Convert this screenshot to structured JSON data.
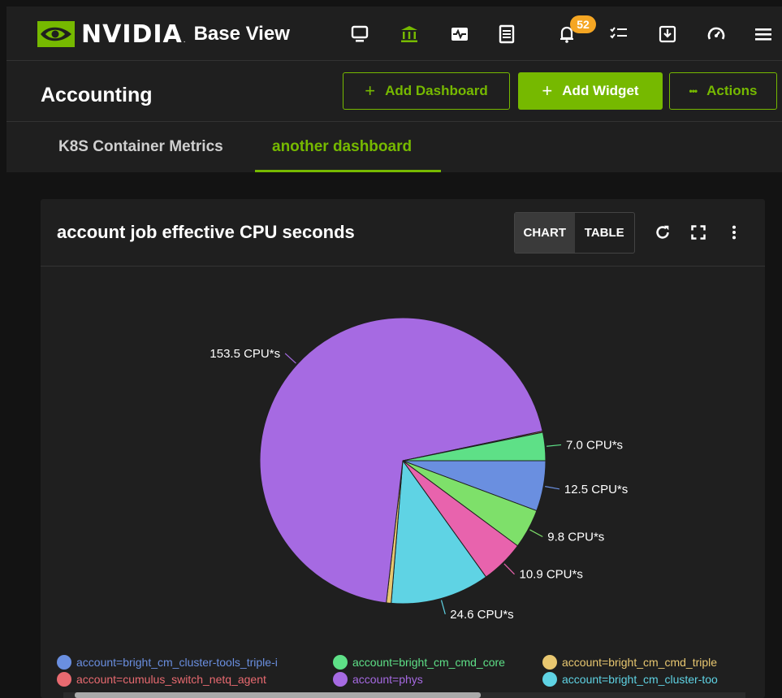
{
  "topbar": {
    "brand_name": "NVIDIA",
    "brand_reg": ".",
    "product": "Base View",
    "notification_count": "52",
    "accent": "#76b900"
  },
  "header": {
    "page_title": "Accounting",
    "add_dashboard": "Add Dashboard",
    "add_widget": "Add Widget",
    "actions": "Actions",
    "actions_dots": "•••",
    "plus": "+"
  },
  "tabs": [
    {
      "label": "K8S Container Metrics",
      "active": false
    },
    {
      "label": "another dashboard",
      "active": true
    }
  ],
  "widget": {
    "title": "account job effective CPU seconds",
    "chart_btn": "CHART",
    "table_btn": "TABLE"
  },
  "chart_data": {
    "type": "pie",
    "slices": [
      {
        "label": "12.5 CPU*s",
        "value": 12.5,
        "color": "#6a8fe0"
      },
      {
        "label": "9.8 CPU*s",
        "value": 9.8,
        "color": "#7ee06a"
      },
      {
        "label": "10.9 CPU*s",
        "value": 10.9,
        "color": "#e863ad"
      },
      {
        "label": "24.6 CPU*s",
        "value": 24.6,
        "color": "#5fd3e4"
      },
      {
        "label": "",
        "value": 1.2,
        "color": "#e8c770"
      },
      {
        "label": "153.5 CPU*s",
        "value": 153.5,
        "color": "#a66ae2"
      },
      {
        "label": "",
        "value": 0.3,
        "color": "#e86a70"
      },
      {
        "label": "7.0 CPU*s",
        "value": 7.0,
        "color": "#5ee087"
      }
    ]
  },
  "legend": [
    {
      "label": "account=bright_cm_cluster-tools_triple-i",
      "color": "#6a8fe0"
    },
    {
      "label": "account=bright_cm_cmd_core",
      "color": "#5ee087"
    },
    {
      "label": "account=bright_cm_cmd_triple",
      "color": "#e8c770"
    },
    {
      "label": "account=cumulus_switch_netq_agent",
      "color": "#e86a70"
    },
    {
      "label": "account=phys",
      "color": "#a66ae2"
    },
    {
      "label": "account=bright_cm_cluster-too",
      "color": "#5fd3e4"
    }
  ]
}
